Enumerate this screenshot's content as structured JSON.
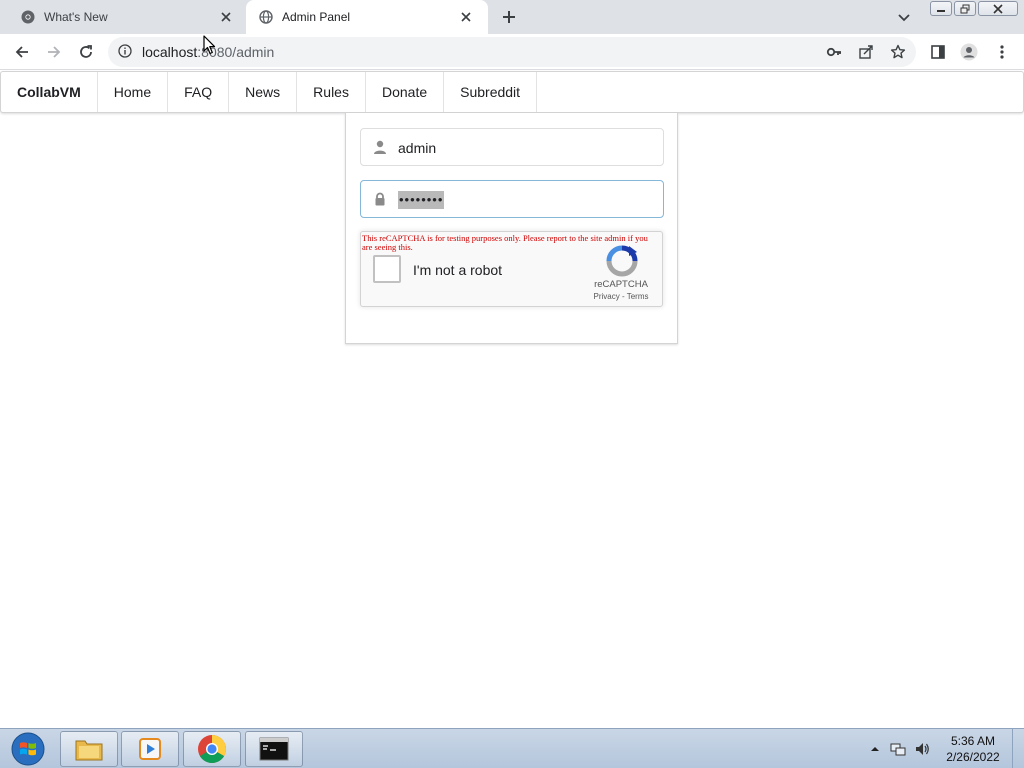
{
  "browser": {
    "tabs": [
      {
        "title": "What's New",
        "active": false,
        "icon": "chrome-icon"
      },
      {
        "title": "Admin Panel",
        "active": true,
        "icon": "globe-icon"
      }
    ],
    "url_host": "localhost",
    "url_rest": ":8080/admin"
  },
  "site_nav": {
    "brand": "CollabVM",
    "items": [
      "Home",
      "FAQ",
      "News",
      "Rules",
      "Donate",
      "Subreddit"
    ]
  },
  "login": {
    "username_value": "admin",
    "password_value": "••••••••"
  },
  "recaptcha": {
    "warning": "This reCAPTCHA is for testing purposes only. Please report to the site admin if you are seeing this.",
    "label": "I'm not a robot",
    "brand": "reCAPTCHA",
    "links": "Privacy - Terms"
  },
  "taskbar": {
    "time": "5:36 AM",
    "date": "2/26/2022"
  },
  "colors": {
    "tabstrip": "#dee1e6",
    "accent_focus": "#85b7d9",
    "warning_red": "#d00000",
    "taskbar": "#c9d6e6"
  }
}
